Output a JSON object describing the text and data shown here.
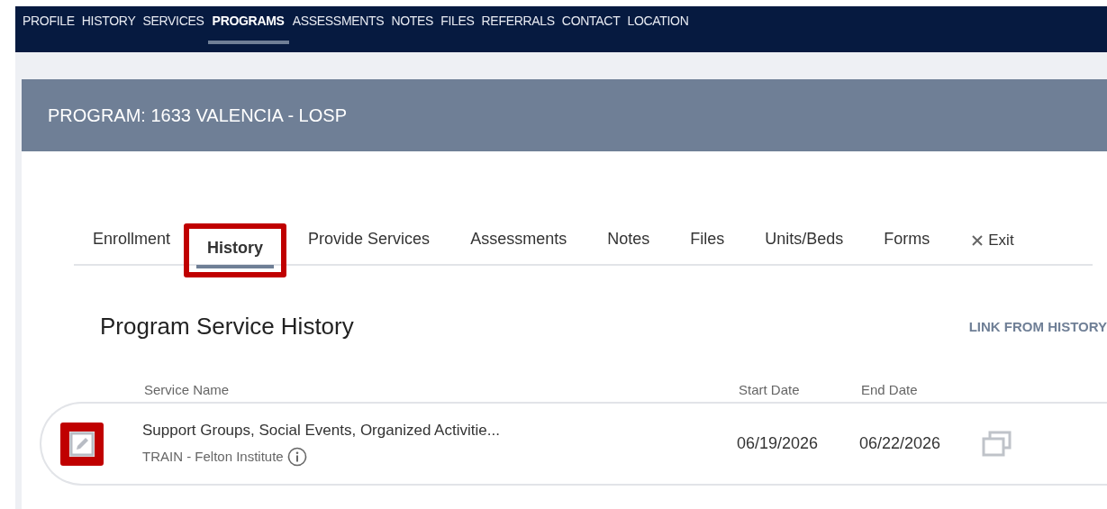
{
  "top_nav": [
    {
      "label": "PROFILE",
      "selected": false
    },
    {
      "label": "HISTORY",
      "selected": false
    },
    {
      "label": "SERVICES",
      "selected": false
    },
    {
      "label": "PROGRAMS",
      "selected": true
    },
    {
      "label": "ASSESSMENTS",
      "selected": false
    },
    {
      "label": "NOTES",
      "selected": false
    },
    {
      "label": "FILES",
      "selected": false
    },
    {
      "label": "REFERRALS",
      "selected": false
    },
    {
      "label": "CONTACT",
      "selected": false
    },
    {
      "label": "LOCATION",
      "selected": false
    }
  ],
  "program_title": "PROGRAM: 1633 VALENCIA - LOSP",
  "tabs": [
    {
      "label": "Enrollment",
      "selected": false,
      "highlighted": false
    },
    {
      "label": "History",
      "selected": true,
      "highlighted": true
    },
    {
      "label": "Provide Services",
      "selected": false,
      "highlighted": false
    },
    {
      "label": "Assessments",
      "selected": false,
      "highlighted": false
    },
    {
      "label": "Notes",
      "selected": false,
      "highlighted": false
    },
    {
      "label": "Files",
      "selected": false,
      "highlighted": false
    },
    {
      "label": "Units/Beds",
      "selected": false,
      "highlighted": false
    },
    {
      "label": "Forms",
      "selected": false,
      "highlighted": false
    }
  ],
  "exit_label": "Exit",
  "section_title": "Program Service History",
  "link_from_history": "LINK FROM HISTORY",
  "table": {
    "columns": [
      "Service Name",
      "Start Date",
      "End Date"
    ],
    "rows": [
      {
        "service_name": "Support Groups, Social Events, Organized Activitie...",
        "provider": "TRAIN - Felton Institute",
        "start_date": "06/19/2026",
        "end_date": "06/22/2026",
        "edit_highlighted": true
      }
    ]
  }
}
